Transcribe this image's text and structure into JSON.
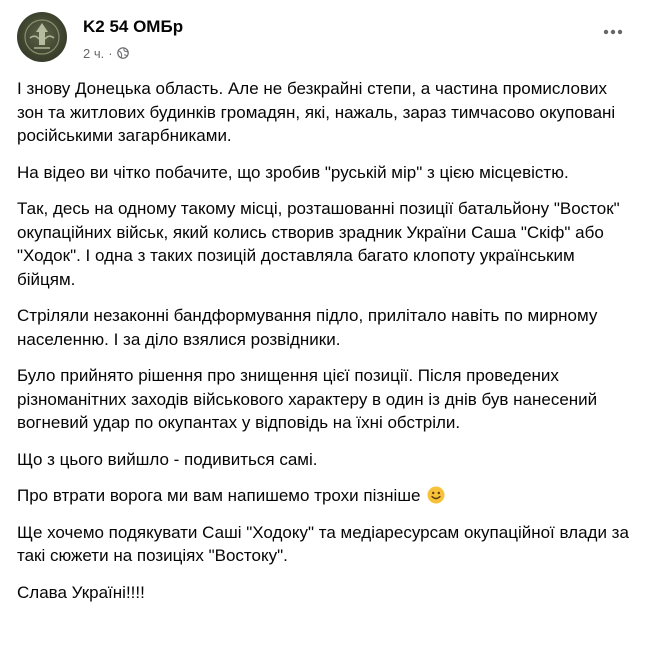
{
  "post": {
    "author": "K2 54 ОМБр",
    "time": "2 ч.",
    "separator": "·",
    "privacy_icon": "globe-icon",
    "menu_icon": "more-horizontal-icon",
    "paragraphs": [
      "І знову Донецька область. Але не безкрайні степи, а частина промислових зон та житлових будинків громадян, які, нажаль, зараз тимчасово окуповані російськими загарбниками.",
      "На відео ви чітко побачите, що зробив \"руській мір\" з цією місцевістю.",
      "Так, десь на одному такому місці, розташованні позиції батальйону \"Восток\" окупаційних військ, який колись створив зрадник України Саша \"Скіф\" або \"Ходок\". І одна з таких позицій доставляла багато клопоту українським бійцям.",
      "Стріляли незаконні бандформування підло, прилітало навіть по мирному населенню. І за діло взялися розвідники.",
      "Було прийнято рішення про знищення цієї позиції. Після проведених різноманітних заходів військового характеру в один із днів був нанесений вогневий удар по окупантах у відповідь на їхні обстріли.",
      "Що з цього вийшло - подивиться самі.",
      "Про втрати ворога ми вам напишемо трохи пізніше",
      "Ще хочемо подякувати Саші \"Ходоку\" та медіаресурсам окупаційної влади за такі сюжети на позиціях \"Востоку\".",
      "Слава Україні!!!!"
    ],
    "emoji_icon": "smiling-face-icon",
    "colors": {
      "text": "#050505",
      "secondary": "#65676b",
      "avatar": "#3f4430",
      "emoji": "#f7c23a"
    }
  }
}
